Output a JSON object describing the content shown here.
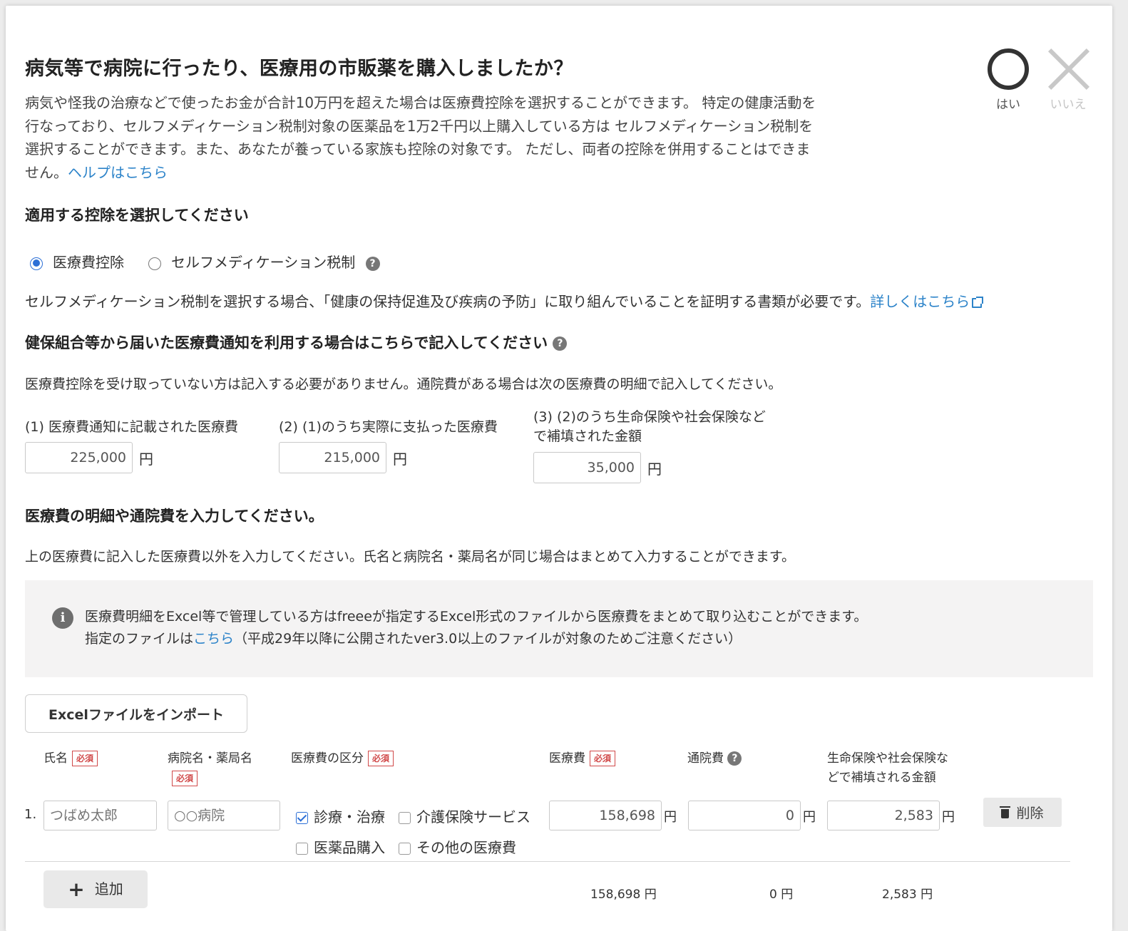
{
  "header": {
    "title": "病気等で病院に行ったり、医療用の市販薬を購入しましたか？",
    "description": "病気や怪我の治療などで使ったお金が合計10万円を超えた場合は医療費控除を選択することができます。 特定の健康活動を行なっており、セルフメディケーション税制対象の医薬品を1万2千円以上購入している方は セルフメディケーション税制を選択することができます。また、あなたが養っている家族も控除の対象です。 ただし、両者の控除を併用することはできません。",
    "help_link": "ヘルプはこちら",
    "yes_label": "はい",
    "no_label": "いいえ"
  },
  "deduction": {
    "heading": "適用する控除を選択してください",
    "options": [
      {
        "label": "医療費控除",
        "selected": true
      },
      {
        "label": "セルフメディケーション税制",
        "selected": false
      }
    ],
    "note": "セルフメディケーション税制を選択する場合、「健康の保持促進及び疾病の予防」に取り組んでいることを証明する書類が必要です。",
    "note_link": "詳しくはこちら"
  },
  "notice": {
    "heading": "健保組合等から届いた医療費通知を利用する場合はこちらで記入してください",
    "text": "医療費控除を受け取っていない方は記入する必要がありません。通院費がある場合は次の医療費の明細で記入してください。",
    "fields": [
      {
        "label_line1": "(1) 医療費通知に記載された医療費",
        "label_line2": "",
        "value": "225,000",
        "unit": "円"
      },
      {
        "label_line1": "(2) (1)のうち実際に支払った医療費",
        "label_line2": "",
        "value": "215,000",
        "unit": "円"
      },
      {
        "label_line1": "(3) (2)のうち生命保険や社会保険など",
        "label_line2": "で補填された金額",
        "value": "35,000",
        "unit": "円"
      }
    ]
  },
  "details": {
    "heading": "医療費の明細や通院費を入力してください。",
    "text": "上の医療費に記入した医療費以外を入力してください。氏名と病院名・薬局名が同じ場合はまとめて入力することができます。",
    "info_line1": "医療費明細をExcel等で管理している方はfreeeが指定するExcel形式のファイルから医療費をまとめて取り込むことができます。",
    "info_line2_pre": "指定のファイルは",
    "info_line2_link": "こちら",
    "info_line2_post": "（平成29年以降に公開されたver3.0以上のファイルが対象のためご注意ください）",
    "import_button": "Excelファイルをインポート"
  },
  "table": {
    "headers": {
      "name": "氏名",
      "hospital": "病院名・薬局名",
      "category": "医療費の区分",
      "cost": "医療費",
      "transport": "通院費",
      "insurance_line1": "生命保険や社会保険な",
      "insurance_line2": "どで補填される金額"
    },
    "required_label": "必須",
    "rows": [
      {
        "index": "1.",
        "name_placeholder": "つばめ太郎",
        "hospital_placeholder": "○○病院",
        "categories": [
          {
            "label": "診療・治療",
            "checked": true
          },
          {
            "label": "介護保険サービス",
            "checked": false
          },
          {
            "label": "医薬品購入",
            "checked": false
          },
          {
            "label": "その他の医療費",
            "checked": false
          }
        ],
        "cost": "158,698",
        "transport": "0",
        "insurance": "2,583",
        "unit": "円",
        "delete_label": "削除"
      }
    ],
    "add_button": "追加",
    "totals": {
      "cost": "158,698 円",
      "transport": "0 円",
      "insurance": "2,583 円"
    }
  }
}
